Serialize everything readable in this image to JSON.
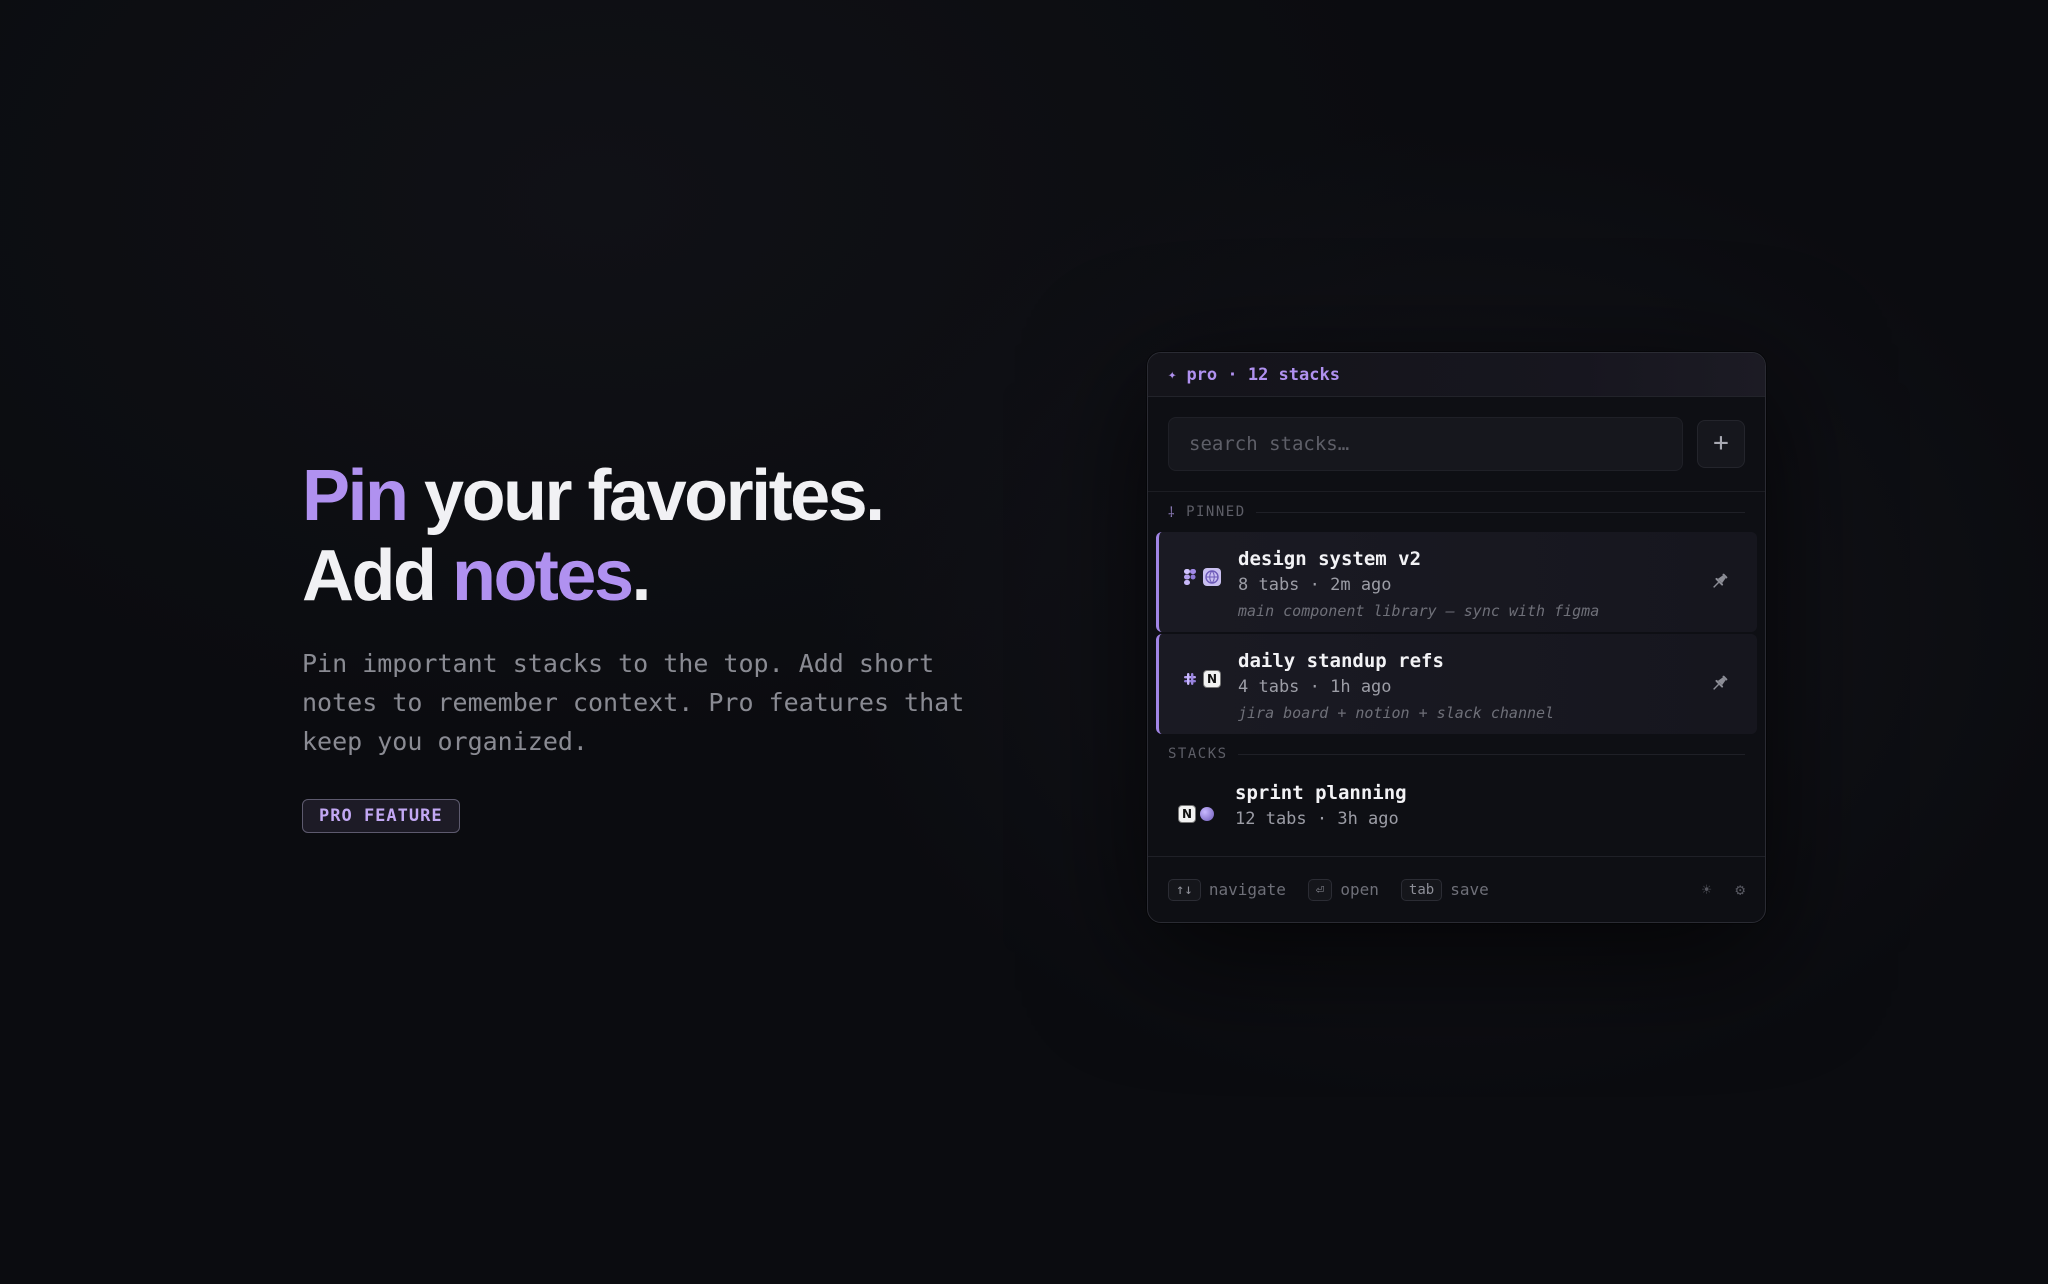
{
  "hero": {
    "line1_accent": "Pin",
    "line1_rest": " your favorites.",
    "line2_start": "Add ",
    "line2_accent": "notes",
    "line2_end": ".",
    "description": "Pin important stacks to the top. Add short notes to remember context. Pro features that keep you organized.",
    "badge": "PRO FEATURE"
  },
  "panel": {
    "header_icon": "sparkle-icon",
    "header_text": "pro · 12 stacks",
    "search_placeholder": "search stacks…",
    "add_label": "+",
    "pinned_label": "PINNED",
    "stacks_label": "STACKS",
    "pinned_items": [
      {
        "title": "design system v2",
        "meta": "8 tabs · 2m ago",
        "note": "main component library — sync with figma",
        "icons": [
          "figma-icon",
          "globe-icon"
        ]
      },
      {
        "title": "daily standup refs",
        "meta": "4 tabs · 1h ago",
        "note": "jira board + notion + slack channel",
        "icons": [
          "slack-icon",
          "notion-icon"
        ]
      }
    ],
    "stack_items": [
      {
        "title": "sprint planning",
        "meta": "12 tabs · 3h ago",
        "icons": [
          "notion-icon",
          "orb-icon"
        ]
      }
    ],
    "footer": {
      "navigate_key": "↑↓",
      "navigate_label": "navigate",
      "open_key": "⏎",
      "open_label": "open",
      "save_key": "tab",
      "save_label": "save"
    }
  },
  "colors": {
    "accent": "#b091f0",
    "background": "#0b0c10",
    "panel": "#0e0f14"
  }
}
